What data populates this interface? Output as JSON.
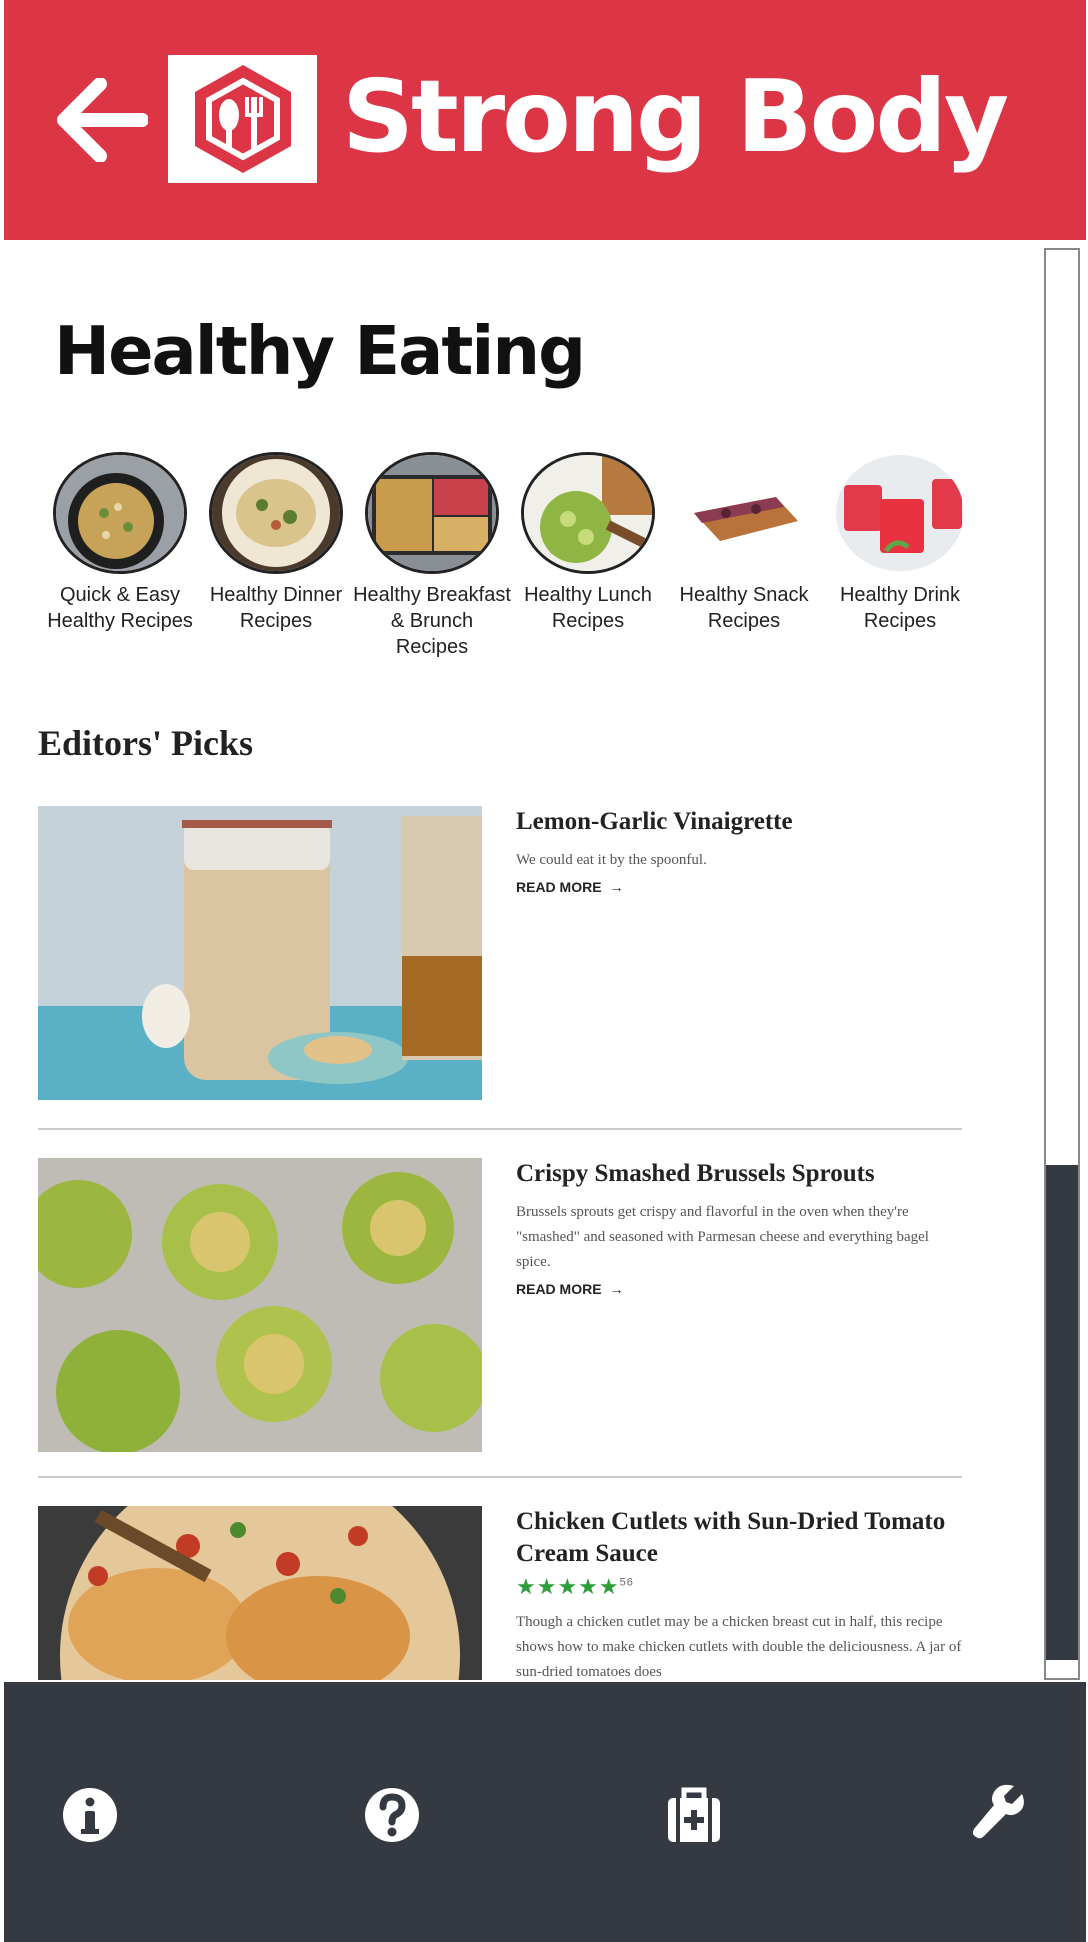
{
  "appbar": {
    "title": "Strong Body"
  },
  "page": {
    "title": "Healthy Eating"
  },
  "categories": [
    {
      "label": "Quick & Easy Healthy Recipes"
    },
    {
      "label": "Healthy Dinner Recipes"
    },
    {
      "label": "Healthy Breakfast & Brunch Recipes"
    },
    {
      "label": "Healthy Lunch Recipes"
    },
    {
      "label": "Healthy Snack Recipes"
    },
    {
      "label": "Healthy Drink Recipes"
    }
  ],
  "editors_picks": {
    "title": "Editors' Picks",
    "items": [
      {
        "title": "Lemon-Garlic Vinaigrette",
        "description": "We could eat it by the spoonful.",
        "read_more": "READ MORE"
      },
      {
        "title": "Crispy Smashed Brussels Sprouts",
        "description": "Brussels sprouts get crispy and flavorful in the oven when they're \"smashed\" and seasoned with Parmesan cheese and everything bagel spice.",
        "read_more": "READ MORE"
      },
      {
        "title": "Chicken Cutlets with Sun-Dried Tomato Cream Sauce",
        "rating_stars": "★★★★★",
        "rating_count": "56",
        "description": "Though a chicken cutlet may be a chicken breast cut in half, this recipe shows how to make chicken cutlets with double the deliciousness. A jar of sun-dried tomatoes does"
      }
    ]
  },
  "bottom_nav": [
    "info-icon",
    "help-icon",
    "first-aid-kit-icon",
    "wrench-icon"
  ],
  "colors": {
    "brand": "#dc3545",
    "nav": "#353a42"
  }
}
